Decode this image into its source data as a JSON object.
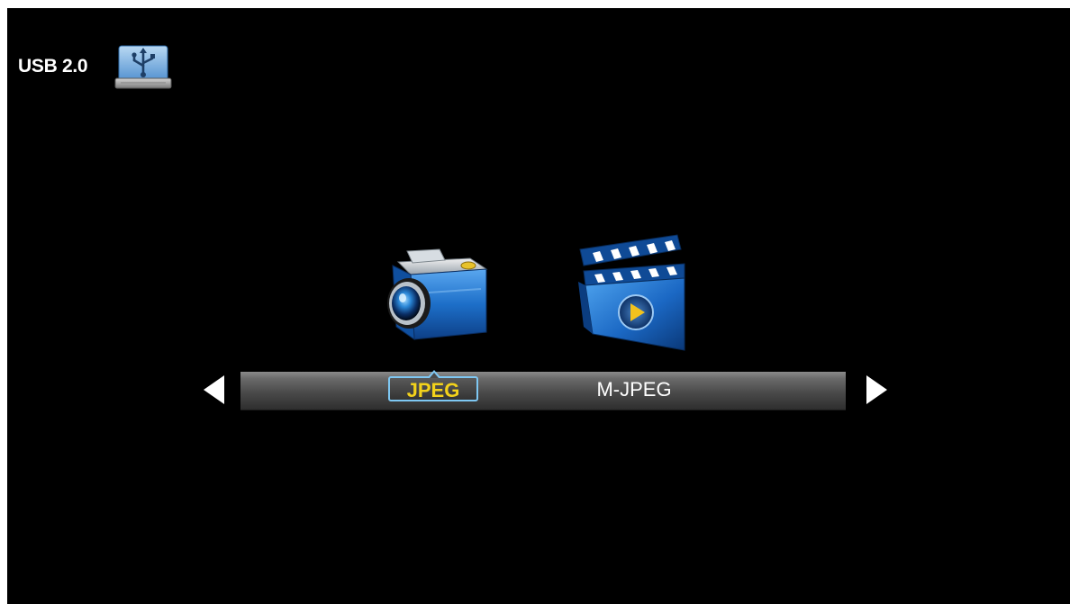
{
  "header": {
    "source_label": "USB 2.0",
    "source_icon": "usb-drive-icon"
  },
  "media_menu": {
    "selected_index": 0,
    "items": [
      {
        "label": "JPEG",
        "icon": "camera-icon",
        "selected": true
      },
      {
        "label": "M-JPEG",
        "icon": "movie-clapper-icon",
        "selected": false
      }
    ],
    "nav_left_icon": "triangle-left-icon",
    "nav_right_icon": "triangle-right-icon"
  },
  "colors": {
    "background": "#000000",
    "bar_top": "#8b8b8b",
    "bar_bottom": "#2e2e2e",
    "selected_text": "#f3d21b",
    "selected_border": "#7ec7f2",
    "icon_blue": "#1d6fc9",
    "text": "#ffffff"
  }
}
